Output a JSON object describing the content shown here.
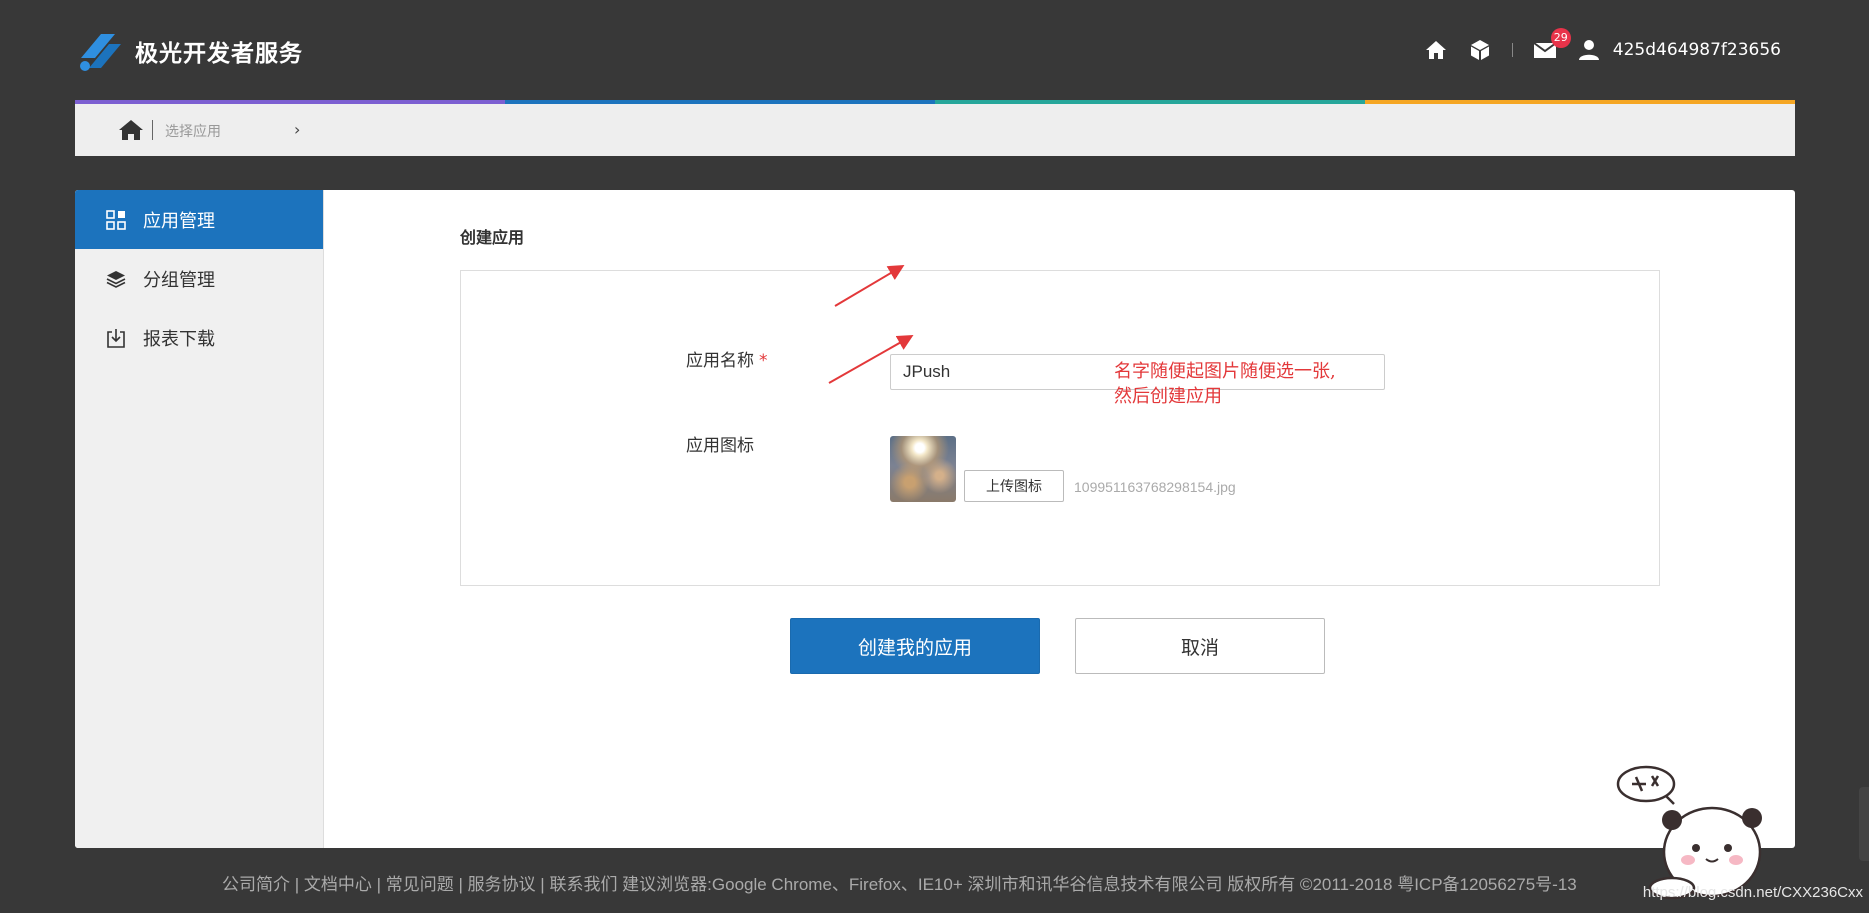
{
  "header": {
    "brand": "极光开发者服务",
    "notification_count": "29",
    "username": "425d464987f23656",
    "icons": [
      "home-icon",
      "cube-icon",
      "mail-icon",
      "user-icon"
    ]
  },
  "breadcrumb": {
    "current": "选择应用"
  },
  "stripe_colors": [
    "#7c5fd1",
    "#1c73bd",
    "#26a69a",
    "#f5a623"
  ],
  "sidebar": {
    "items": [
      {
        "label": "应用管理",
        "icon": "grid-icon",
        "active": true
      },
      {
        "label": "分组管理",
        "icon": "layers-icon",
        "active": false
      },
      {
        "label": "报表下载",
        "icon": "download-icon",
        "active": false
      }
    ]
  },
  "form": {
    "title": "创建应用",
    "name_label": "应用名称",
    "required_mark": "*",
    "name_value": "JPush",
    "icon_label": "应用图标",
    "upload_label": "上传图标",
    "file_name": "109951163768298154.jpg"
  },
  "annotation": {
    "line1": "名字随便起图片随便选一张,",
    "line2": "然后创建应用"
  },
  "actions": {
    "create_label": "创建我的应用",
    "cancel_label": "取消"
  },
  "footer": {
    "text": "公司简介 | 文档中心 | 常见问题 | 服务协议 | 联系我们   建议浏览器:Google Chrome、Firefox、IE10+   深圳市和讯华谷信息技术有限公司 版权所有 ©2011-2018 粤ICP备12056275号-13",
    "watermark": "https://blog.csdn.net/CXX236Cxx"
  },
  "colors": {
    "background": "#383838",
    "primary": "#1c73bd",
    "annotation": "#e3383a",
    "badge": "#e8334a"
  }
}
